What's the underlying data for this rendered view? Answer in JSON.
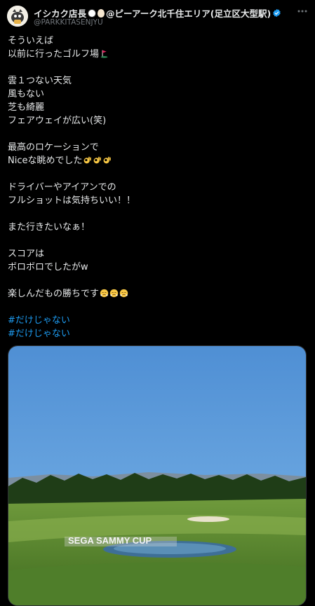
{
  "author": {
    "name_prefix": "イシカク店長",
    "name_suffix": "@ピーアーク北千住エリア(足立区大型駅)",
    "handle": "@PARKKITASENJYU",
    "verified": true
  },
  "post": {
    "lines": [
      {
        "text": "そういえば",
        "emoji": []
      },
      {
        "text": "以前に行ったゴルフ場",
        "emoji": [
          "golf-flag-icon"
        ]
      },
      {
        "text": "",
        "emoji": []
      },
      {
        "text": "雲１つない天気",
        "emoji": []
      },
      {
        "text": "風もない",
        "emoji": []
      },
      {
        "text": "芝も綺麗",
        "emoji": []
      },
      {
        "text": "フェアウェイが広い(笑)",
        "emoji": []
      },
      {
        "text": "",
        "emoji": []
      },
      {
        "text": "最高のロケーションで",
        "emoji": []
      },
      {
        "text": "Niceな眺めでした",
        "emoji": [
          "ok-hand-icon",
          "ok-hand-icon",
          "ok-hand-icon"
        ]
      },
      {
        "text": "",
        "emoji": []
      },
      {
        "text": "ドライバーやアイアンでの",
        "emoji": []
      },
      {
        "text": "フルショットは気持ちいい！！",
        "emoji": []
      },
      {
        "text": "",
        "emoji": []
      },
      {
        "text": "また行きたいなぁ！",
        "emoji": []
      },
      {
        "text": "",
        "emoji": []
      },
      {
        "text": "スコアは",
        "emoji": []
      },
      {
        "text": "ボロボロでしたがw",
        "emoji": []
      },
      {
        "text": "",
        "emoji": []
      },
      {
        "text": "楽しんだもの勝ちです",
        "emoji": [
          "triumph-face-icon",
          "triumph-face-icon",
          "triumph-face-icon"
        ]
      },
      {
        "text": "",
        "emoji": []
      }
    ],
    "hashtags": [
      "#だけじゃない",
      "#だけじゃない"
    ]
  },
  "media": {
    "sign_text": "SEGA SAMMY CUP"
  },
  "colors": {
    "background": "#000000",
    "text": "#e7e9ea",
    "muted": "#71767b",
    "link": "#1d9bf0"
  },
  "icons": {
    "more": "more-dots-icon",
    "verified": "verified-badge-icon"
  }
}
